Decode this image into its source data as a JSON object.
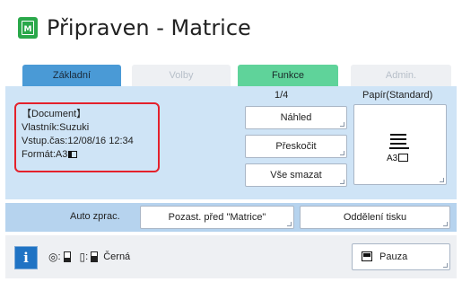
{
  "app": {
    "title": "Připraven - Matrice",
    "icon": "master-icon",
    "icon_letter": "M"
  },
  "tabs": [
    {
      "label": "Základní",
      "active": true
    },
    {
      "label": "Volby",
      "enabled": false
    },
    {
      "label": "Funkce",
      "enabled": true
    },
    {
      "label": "Admin.",
      "enabled": false
    }
  ],
  "document_info": {
    "title": "【Document】",
    "owner": "Vlastník:Suzuki",
    "input_time": "Vstup.čas:12/08/16 12:34",
    "format": "Formát:A3"
  },
  "page_counter": "1/4",
  "paper": {
    "label": "Papír(Standard)",
    "size": "A3",
    "icon": "paper-tray-icon"
  },
  "buttons": {
    "preview": "Náhled",
    "skip": "Přeskočit",
    "clear_all": "Vše smazat",
    "pause_master": "Pozast. před \"Matrice\"",
    "separation": "Oddělení tisku",
    "pause": "Pauza"
  },
  "auto_process_label": "Auto zprac.",
  "status": {
    "ink_color": "Černá",
    "master_icon": "master-roll-icon",
    "ink_icon": "ink-bottle-icon"
  },
  "colors": {
    "accent_blue": "#4a9ad6",
    "functions_green": "#5fd39a",
    "highlight_red": "#e4212b",
    "panel_blue": "#cfe4f6"
  }
}
